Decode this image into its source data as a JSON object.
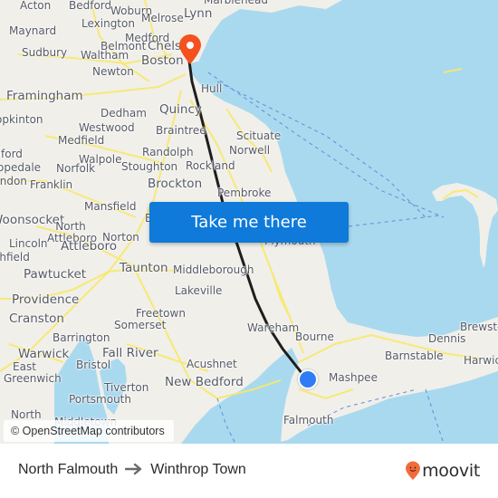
{
  "map": {
    "attribution": "© OpenStreetMap contributors",
    "places": [
      {
        "name": "Acton",
        "size": "normal"
      },
      {
        "name": "Bedford",
        "size": "normal"
      },
      {
        "name": "Woburn",
        "size": "normal"
      },
      {
        "name": "Marblehead",
        "size": "normal"
      },
      {
        "name": "Maynard",
        "size": "normal"
      },
      {
        "name": "Lexington",
        "size": "normal"
      },
      {
        "name": "Melrose",
        "size": "normal"
      },
      {
        "name": "Lynn",
        "size": "big"
      },
      {
        "name": "Medford",
        "size": "normal"
      },
      {
        "name": "Belmont",
        "size": "normal"
      },
      {
        "name": "Chelsea",
        "size": "big"
      },
      {
        "name": "Sudbury",
        "size": "normal"
      },
      {
        "name": "Waltham",
        "size": "normal"
      },
      {
        "name": "Boston",
        "size": "big"
      },
      {
        "name": "Newton",
        "size": "normal"
      },
      {
        "name": "Hull",
        "size": "normal"
      },
      {
        "name": "Framingham",
        "size": "big"
      },
      {
        "name": "Dedham",
        "size": "normal"
      },
      {
        "name": "Quincy",
        "size": "big"
      },
      {
        "name": "Hopkinton",
        "size": "normal"
      },
      {
        "name": "Westwood",
        "size": "normal"
      },
      {
        "name": "Braintree",
        "size": "normal"
      },
      {
        "name": "Scituate",
        "size": "normal"
      },
      {
        "name": "Medfield",
        "size": "normal"
      },
      {
        "name": "Norwell",
        "size": "normal"
      },
      {
        "name": "Milford",
        "size": "normal"
      },
      {
        "name": "Randolph",
        "size": "normal"
      },
      {
        "name": "Walpole",
        "size": "normal"
      },
      {
        "name": "Hopedale",
        "size": "normal"
      },
      {
        "name": "Norfolk",
        "size": "normal"
      },
      {
        "name": "Stoughton",
        "size": "normal"
      },
      {
        "name": "Rockland",
        "size": "normal"
      },
      {
        "name": "Mendon",
        "size": "normal"
      },
      {
        "name": "Franklin",
        "size": "normal"
      },
      {
        "name": "Brockton",
        "size": "big"
      },
      {
        "name": "Pembroke",
        "size": "normal"
      },
      {
        "name": "Woonsocket",
        "size": "big"
      },
      {
        "name": "Mansfield",
        "size": "normal"
      },
      {
        "name": "Bridgewater",
        "size": "normal"
      },
      {
        "name": "North Attleboro",
        "size": "normal"
      },
      {
        "name": "Plymouth",
        "size": "normal"
      },
      {
        "name": "Lincoln",
        "size": "normal"
      },
      {
        "name": "Norton",
        "size": "normal"
      },
      {
        "name": "Attleboro",
        "size": "big"
      },
      {
        "name": "Smithfield",
        "size": "normal"
      },
      {
        "name": "Pawtucket",
        "size": "big"
      },
      {
        "name": "Taunton",
        "size": "big"
      },
      {
        "name": "Middleborough",
        "size": "normal"
      },
      {
        "name": "Providence",
        "size": "big"
      },
      {
        "name": "Lakeville",
        "size": "normal"
      },
      {
        "name": "Freetown",
        "size": "normal"
      },
      {
        "name": "Cranston",
        "size": "big"
      },
      {
        "name": "Somerset",
        "size": "normal"
      },
      {
        "name": "Wareham",
        "size": "normal"
      },
      {
        "name": "Barrington",
        "size": "normal"
      },
      {
        "name": "Bourne",
        "size": "normal"
      },
      {
        "name": "Brewster",
        "size": "normal"
      },
      {
        "name": "Warwick",
        "size": "big"
      },
      {
        "name": "Fall River",
        "size": "big"
      },
      {
        "name": "Dennis",
        "size": "normal"
      },
      {
        "name": "Barnstable",
        "size": "normal"
      },
      {
        "name": "East Greenwich",
        "size": "normal"
      },
      {
        "name": "Bristol",
        "size": "normal"
      },
      {
        "name": "Acushnet",
        "size": "normal"
      },
      {
        "name": "Mashpee",
        "size": "normal"
      },
      {
        "name": "Harwich",
        "size": "normal"
      },
      {
        "name": "Tiverton",
        "size": "normal"
      },
      {
        "name": "New Bedford",
        "size": "big"
      },
      {
        "name": "Portsmouth",
        "size": "normal"
      },
      {
        "name": "North Kingstown",
        "size": "normal"
      },
      {
        "name": "Middletown",
        "size": "normal"
      },
      {
        "name": "Falmouth",
        "size": "normal"
      }
    ],
    "origin_marker": "current-location-dot",
    "destination_marker": "destination-pin",
    "colors": {
      "water": "#a9d9ef",
      "land": "#f1efe9",
      "road": "#f7e96a",
      "route": "#1e1e1e",
      "origin": "#2f7cf6",
      "destination": "#f4511e",
      "button": "#0f7ad9"
    }
  },
  "cta": {
    "label": "Take me there"
  },
  "footer": {
    "origin": "North Falmouth",
    "destination": "Winthrop Town",
    "arrow_icon": "arrow-right-icon",
    "brand": "moovit",
    "brand_color": "#f26b3a"
  }
}
